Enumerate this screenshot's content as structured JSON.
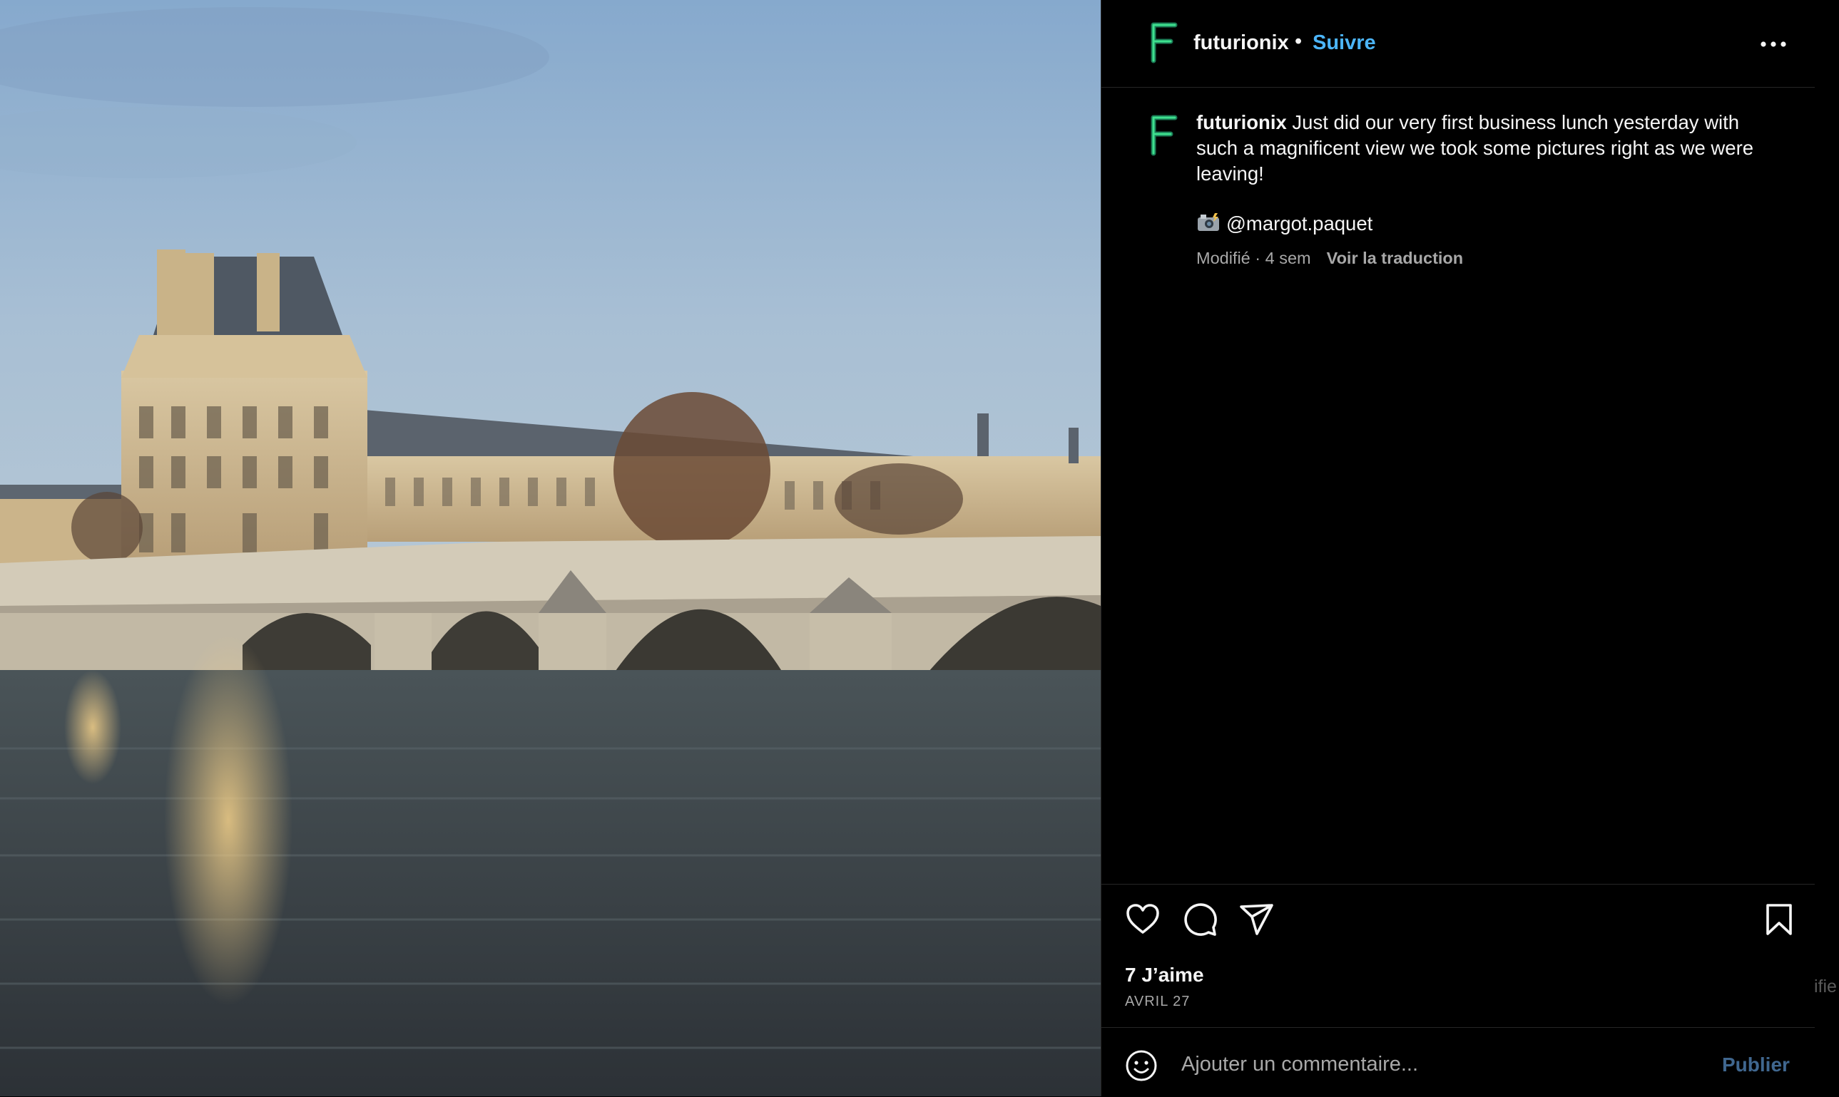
{
  "post": {
    "image_alt": "Louvre palace and Pont Royal over the Seine at dusk"
  },
  "header": {
    "username": "futurionix",
    "separator": "•",
    "follow_label": "Suivre",
    "more_icon": "more-horizontal-icon",
    "avatar_letter": "F"
  },
  "caption": {
    "username": "futurionix",
    "text": " Just did our very first business lunch yesterday with such a magnificent view we took some pictures right as we were leaving!",
    "credit_icon": "camera-flash-emoji",
    "credit_mention": "@margot.paquet",
    "edited_label": "Modifié · 4 sem",
    "translate_label": "Voir la traduction"
  },
  "actions": {
    "like_icon": "heart-icon",
    "comment_icon": "comment-icon",
    "share_icon": "send-icon",
    "save_icon": "bookmark-icon",
    "likes_label": "7 J’aime",
    "date_label": "AVRIL 27"
  },
  "comment": {
    "emoji_icon": "smiley-icon",
    "placeholder": "Ajouter un commentaire...",
    "publish_label": "Publier"
  },
  "offpage_fragment": "ifie",
  "colors": {
    "background": "#000000",
    "text": "#f5f5f5",
    "secondary_text": "#a8a8a8",
    "link_blue": "#4cb5f9",
    "publish_blue": "#4c7aa8",
    "divider": "#262626"
  }
}
